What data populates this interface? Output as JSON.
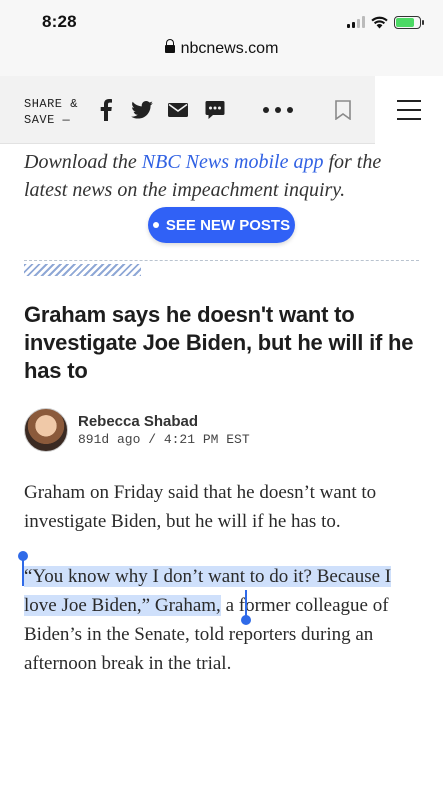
{
  "status_bar": {
    "time": "8:28",
    "battery_level": 0.8,
    "battery_color": "#4cd964"
  },
  "browser": {
    "url": "nbcnews.com",
    "lock_icon": "lock-icon"
  },
  "share_toolbar": {
    "label_line1": "SHARE &",
    "label_line2": "SAVE —",
    "icons": [
      "facebook-icon",
      "twitter-icon",
      "email-icon",
      "sms-icon",
      "more-icon",
      "bookmark-icon"
    ],
    "menu_icon": "hamburger-menu-icon"
  },
  "promo": {
    "prefix": "Download the ",
    "link": "NBC News mobile app",
    "suffix": " for the latest news on the impeachment inquiry.",
    "link_color": "#3061e3"
  },
  "see_new_posts": {
    "label": "SEE NEW POSTS",
    "color": "#3061f6"
  },
  "post": {
    "headline": "Graham says he doesn't want to investigate Joe Biden, but he will if he has to",
    "author": "Rebecca Shabad",
    "meta": "891d ago / 4:21 PM EST",
    "paragraph1": "Graham on Friday said that he doesn’t want to investigate Biden, but he will if he has to.",
    "paragraph2_selected": "“You know why I don’t want to do it? Because I love Joe Biden,” Graham,",
    "paragraph2_rest": " a former colleague of Biden’s in the Senate, told reporters during an afternoon break in the trial.",
    "selection_color": "#cfe0fb"
  }
}
